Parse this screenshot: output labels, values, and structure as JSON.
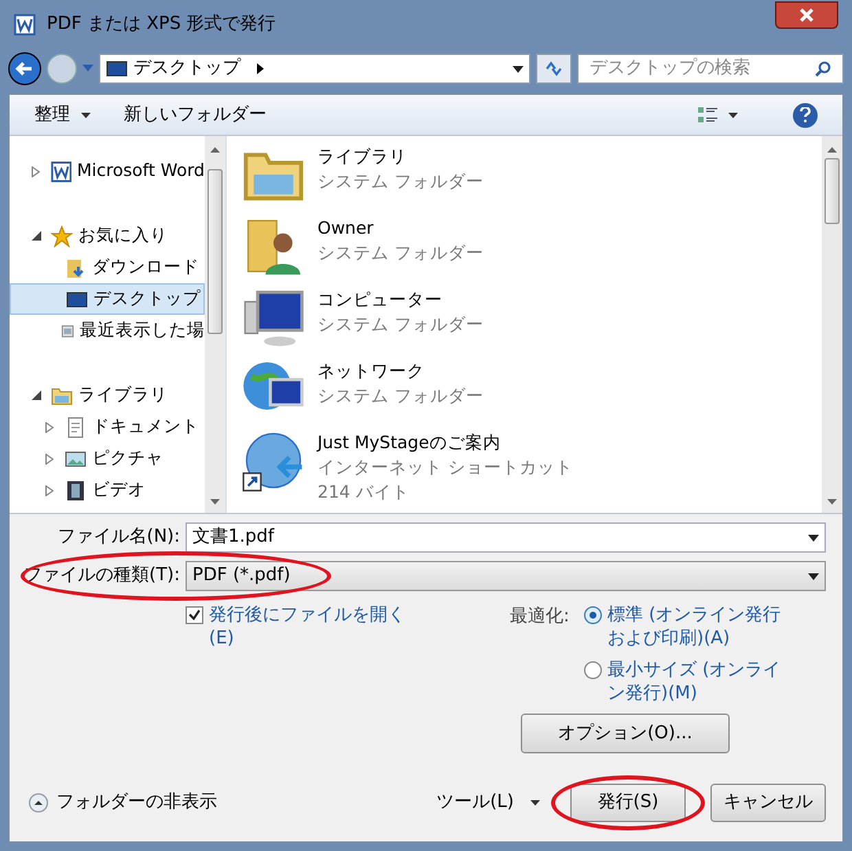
{
  "window": {
    "title": "PDF または XPS 形式で発行"
  },
  "address": {
    "location": "デスクトップ",
    "search_placeholder": "デスクトップの検索"
  },
  "toolbar": {
    "organize": "整理",
    "new_folder": "新しいフォルダー"
  },
  "sidebar": {
    "items": [
      {
        "label": "Microsoft Word",
        "kind": "word",
        "expanded": false,
        "selected": false
      },
      {
        "label": "お気に入り",
        "kind": "star",
        "expanded": true,
        "selected": false,
        "children": [
          {
            "label": "ダウンロード",
            "kind": "download",
            "selected": false
          },
          {
            "label": "デスクトップ",
            "kind": "desktop",
            "selected": true
          },
          {
            "label": "最近表示した場",
            "kind": "recent",
            "selected": false
          }
        ]
      },
      {
        "label": "ライブラリ",
        "kind": "library",
        "expanded": true,
        "selected": false,
        "children": [
          {
            "label": "ドキュメント",
            "kind": "document",
            "selected": false,
            "expanded": false
          },
          {
            "label": "ピクチャ",
            "kind": "picture",
            "selected": false,
            "expanded": false
          },
          {
            "label": "ビデオ",
            "kind": "video",
            "selected": false,
            "expanded": false
          }
        ]
      }
    ]
  },
  "files": [
    {
      "name": "ライブラリ",
      "type": "システム フォルダー",
      "kind": "library"
    },
    {
      "name": "Owner",
      "type": "システム フォルダー",
      "kind": "user"
    },
    {
      "name": "コンピューター",
      "type": "システム フォルダー",
      "kind": "computer"
    },
    {
      "name": "ネットワーク",
      "type": "システム フォルダー",
      "kind": "network"
    },
    {
      "name": "Just MyStageのご案内",
      "type": "インターネット ショートカット",
      "size": "214 バイト",
      "kind": "shortcut"
    }
  ],
  "file_name": {
    "label": "ファイル名(N):",
    "value": "文書1.pdf"
  },
  "file_type": {
    "label": "ファイルの種類(T):",
    "value": "PDF (*.pdf)",
    "highlighted": true
  },
  "open_after": {
    "label": "発行後にファイルを開く",
    "accel": "(E)",
    "checked": true
  },
  "optimize": {
    "label": "最適化:",
    "options": [
      {
        "line1": "標準 (オンライン発行",
        "line2": "および印刷)(A)",
        "selected": true
      },
      {
        "line1": "最小サイズ (オンライ",
        "line2": "ン発行)(M)",
        "selected": false
      }
    ]
  },
  "options_button": "オプション(O)...",
  "hide_folders": "フォルダーの非表示",
  "tools": "ツール(L)",
  "publish": {
    "label": "発行(S)",
    "highlighted": true
  },
  "cancel": "キャンセル"
}
